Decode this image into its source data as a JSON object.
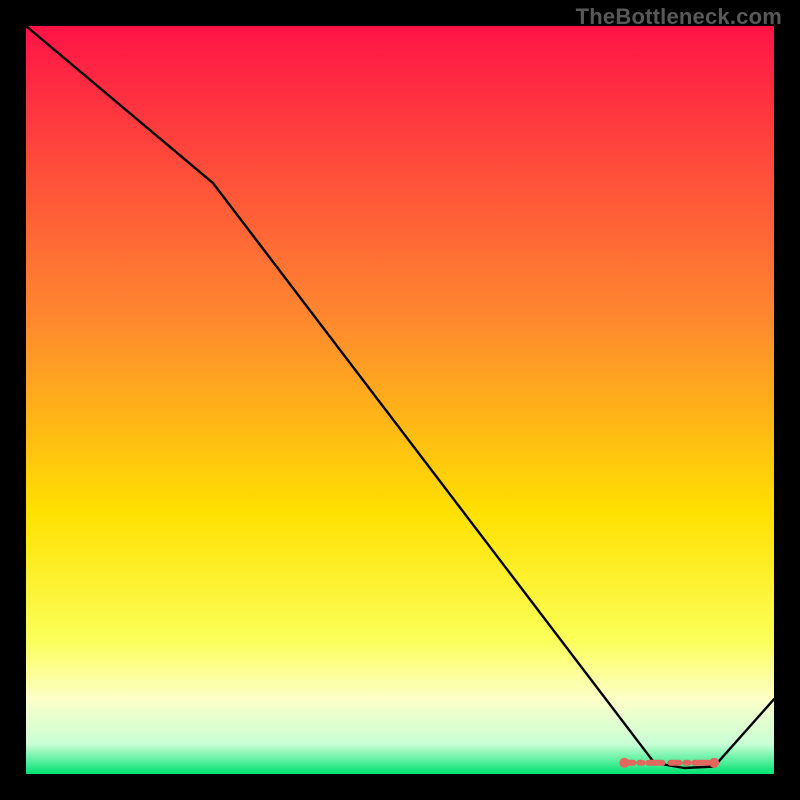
{
  "watermark": "TheBottleneck.com",
  "chart_data": {
    "type": "line",
    "title": "",
    "xlabel": "",
    "ylabel": "",
    "xlim": [
      0,
      100
    ],
    "ylim": [
      0,
      100
    ],
    "grid": false,
    "x": [
      0,
      25,
      84,
      88,
      92,
      100
    ],
    "values": [
      100,
      79,
      1.5,
      0.8,
      1.0,
      10
    ],
    "annotations": [
      {
        "type": "marker-run",
        "x_start": 80,
        "x_end": 92,
        "y": 1.5,
        "color": "#e2675e"
      }
    ],
    "gradient_stops": [
      {
        "pct": 0,
        "color": "#ff1447"
      },
      {
        "pct": 40,
        "color": "#ff8b2e"
      },
      {
        "pct": 65,
        "color": "#ffe000"
      },
      {
        "pct": 82,
        "color": "#fbff58"
      },
      {
        "pct": 90,
        "color": "#fdffc8"
      },
      {
        "pct": 96,
        "color": "#c9ffd6"
      },
      {
        "pct": 100,
        "color": "#00e371"
      }
    ],
    "line_color": "#000000"
  }
}
